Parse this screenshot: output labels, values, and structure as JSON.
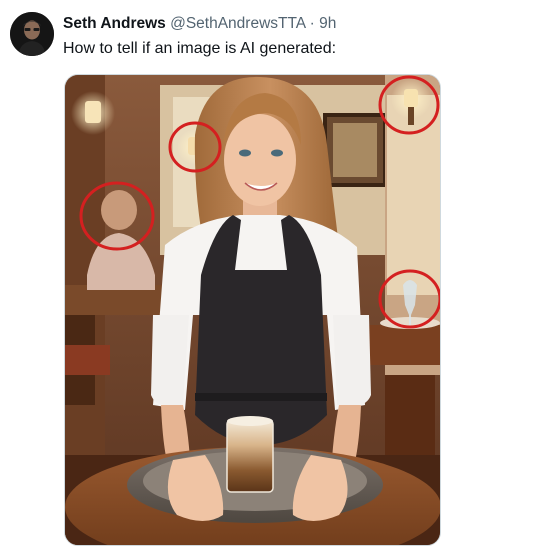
{
  "tweet": {
    "author_name": "Seth Andrews",
    "author_handle": "@SethAndrewsTTA",
    "separator": "·",
    "timestamp": "9h",
    "text": "How to tell if an image is AI generated:"
  },
  "media": {
    "annotation_color": "#d42020",
    "annotations": [
      "lamp-left-circle",
      "lamp-right-circle",
      "person-background-circle",
      "wine-glass-circle"
    ]
  },
  "icons": {
    "avatar": "author-avatar"
  }
}
